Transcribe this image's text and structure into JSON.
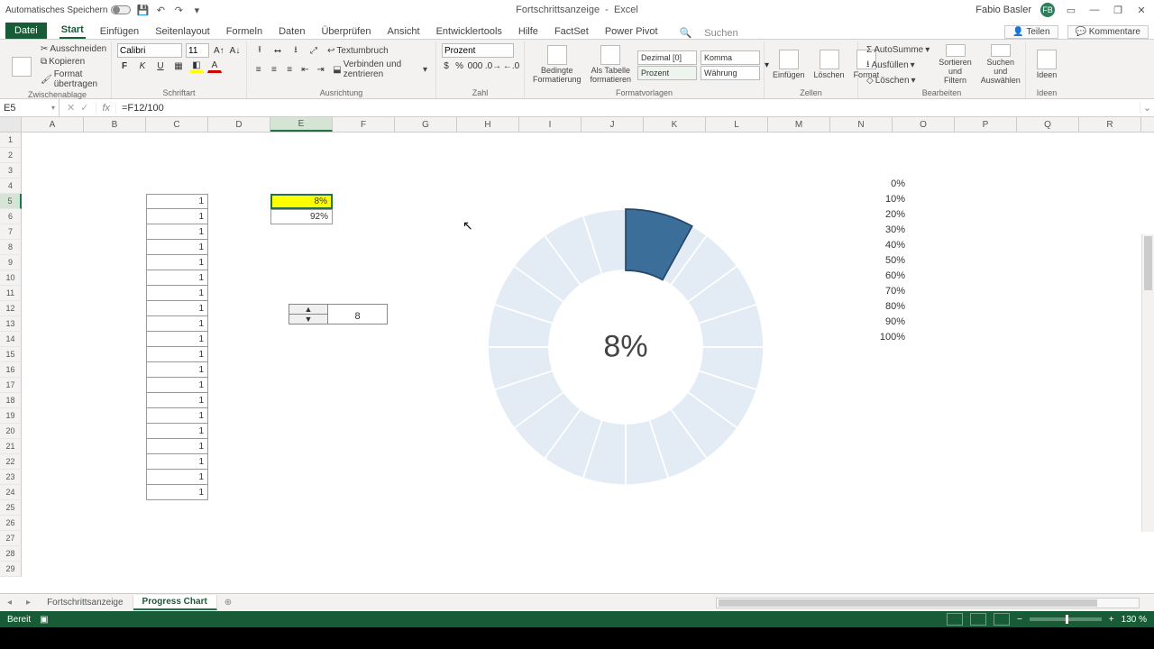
{
  "title": {
    "doc": "Fortschrittsanzeige",
    "app": "Excel",
    "autosave": "Automatisches Speichern"
  },
  "user": {
    "name": "Fabio Basler",
    "initials": "FB"
  },
  "tabs": {
    "file": "Datei",
    "items": [
      "Start",
      "Einfügen",
      "Seitenlayout",
      "Formeln",
      "Daten",
      "Überprüfen",
      "Ansicht",
      "Entwicklertools",
      "Hilfe",
      "FactSet",
      "Power Pivot"
    ],
    "search": "Suchen",
    "share": "Teilen",
    "comments": "Kommentare"
  },
  "ribbon": {
    "clipboard": {
      "label": "Zwischenablage",
      "cut": "Ausschneiden",
      "copy": "Kopieren",
      "fmtpaint": "Format übertragen"
    },
    "font": {
      "label": "Schriftart",
      "name": "Calibri",
      "size": "11"
    },
    "align": {
      "label": "Ausrichtung",
      "wrap": "Textumbruch",
      "merge": "Verbinden und zentrieren"
    },
    "number": {
      "label": "Zahl",
      "format": "Prozent"
    },
    "styles": {
      "label": "Formatvorlagen",
      "cond": "Bedingte Formatierung",
      "astable": "Als Tabelle formatieren",
      "s1": "Dezimal [0]",
      "s2": "Komma",
      "s3": "Prozent",
      "s4": "Währung"
    },
    "cells": {
      "label": "Zellen",
      "ins": "Einfügen",
      "del": "Löschen",
      "fmt": "Format"
    },
    "editing": {
      "label": "Bearbeiten",
      "sum": "AutoSumme",
      "fill": "Ausfüllen",
      "clear": "Löschen",
      "sort": "Sortieren und Filtern",
      "find": "Suchen und Auswählen"
    },
    "ideas": {
      "label": "Ideen",
      "btn": "Ideen"
    }
  },
  "namebox": "E5",
  "formula": "=F12/100",
  "columns": [
    "A",
    "B",
    "C",
    "D",
    "E",
    "F",
    "G",
    "H",
    "I",
    "J",
    "K",
    "L",
    "M",
    "N",
    "O",
    "P",
    "Q",
    "R"
  ],
  "rowcount": 29,
  "col_c_value": "1",
  "cells": {
    "e5": "8%",
    "e6": "92%"
  },
  "spinner": {
    "value": "8"
  },
  "percent_list": [
    "0%",
    "10%",
    "20%",
    "30%",
    "40%",
    "50%",
    "60%",
    "70%",
    "80%",
    "90%",
    "100%"
  ],
  "chart_data": {
    "type": "pie",
    "title": "",
    "center_label": "8%",
    "series": [
      {
        "name": "progress",
        "values": [
          8
        ],
        "color": "#3b6e99"
      },
      {
        "name": "remaining_segments",
        "values": [
          4.6,
          4.6,
          4.6,
          4.6,
          4.6,
          4.6,
          4.6,
          4.6,
          4.6,
          4.6,
          4.6,
          4.6,
          4.6,
          4.6,
          4.6,
          4.6,
          4.6,
          4.6,
          4.6,
          4.6
        ],
        "color": "#dde7f0"
      }
    ],
    "donut_inner_ratio": 0.55
  },
  "sheets": {
    "tabs": [
      "Fortschrittsanzeige",
      "Progress Chart"
    ],
    "active": 1
  },
  "status": {
    "ready": "Bereit",
    "zoom": "130 %"
  }
}
